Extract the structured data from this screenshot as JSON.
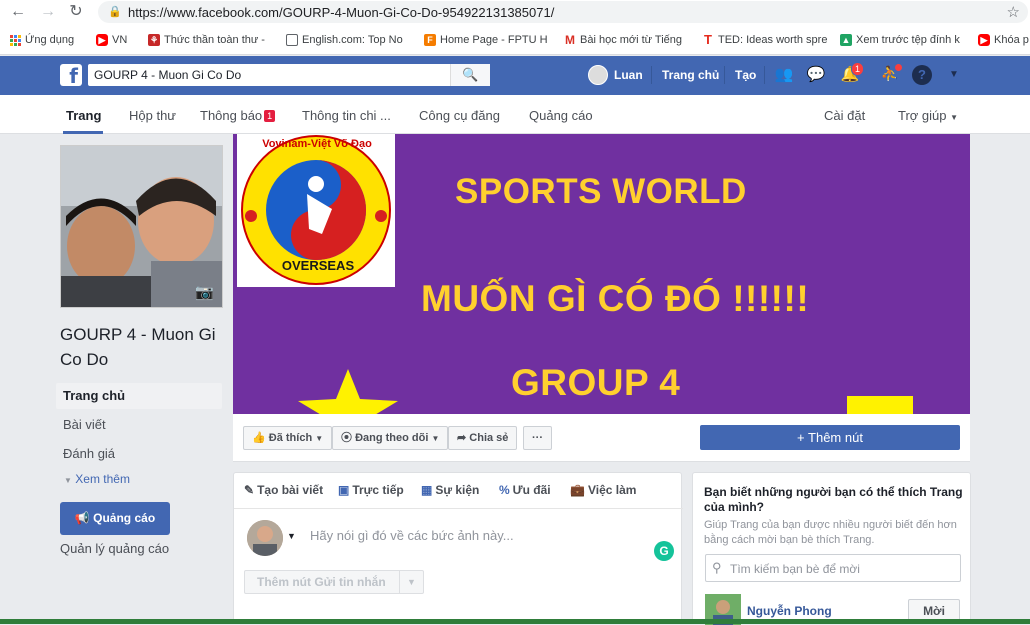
{
  "browser": {
    "url": "https://www.facebook.com/GOURP-4-Muon-Gi-Co-Do-954922131385071/",
    "bookmarks": [
      {
        "label": "Ứng dụng",
        "icon": "apps-grid-icon",
        "color": "#ea4335"
      },
      {
        "label": "VN",
        "icon": "youtube-icon",
        "color": "#ff0000"
      },
      {
        "label": "Thức thần toàn thư -",
        "icon": "site-icon",
        "color": "#c62828"
      },
      {
        "label": "English.com: Top No",
        "icon": "page-icon",
        "color": "#5f6368"
      },
      {
        "label": "Home Page - FPTU H",
        "icon": "fpt-icon",
        "color": "#f57c00"
      },
      {
        "label": "Bài học mới từ Tiếng",
        "icon": "gmail-icon",
        "color": "#d93025"
      },
      {
        "label": "TED: Ideas worth spre",
        "icon": "ted-icon",
        "color": "#e62b1e"
      },
      {
        "label": "Xem trước tệp đính k",
        "icon": "drive-icon",
        "color": "#1fa463"
      },
      {
        "label": "Khóa p",
        "icon": "youtube-icon",
        "color": "#ff0000"
      }
    ]
  },
  "fb_header": {
    "search_value": "GOURP 4 - Muon Gi Co Do",
    "user_name": "Luan",
    "home_label": "Trang chủ",
    "create_label": "Tạo",
    "notif_count": "1"
  },
  "page_tabs": {
    "items": [
      "Trang",
      "Hộp thư",
      "Thông báo",
      "Thông tin chi ...",
      "Công cụ đăng",
      "Quảng cáo"
    ],
    "notif_badge": "1",
    "settings": "Cài đặt",
    "help": "Trợ giúp"
  },
  "sidebar": {
    "page_name": "GOURP 4 - Muon Gi Co Do",
    "nav": [
      "Trang chủ",
      "Bài viết",
      "Đánh giá"
    ],
    "see_more": "Xem thêm",
    "ads_button": "Quảng cáo",
    "manage_ads": "Quản lý quảng cáo"
  },
  "cover": {
    "line1": "SPORTS WORLD",
    "line2": "MUỐN GÌ CÓ ĐÓ !!!!!!",
    "line3": "GROUP 4",
    "logo_top_text": "Vovinam-Việt Võ Đạo",
    "logo_bottom_text": "OVERSEAS"
  },
  "actions": {
    "like": "Đã thích",
    "follow": "Đang theo dõi",
    "share": "Chia sẻ",
    "more": "···",
    "add_button": "Thêm nút"
  },
  "composer": {
    "tabs": [
      "Tạo bài viết",
      "Trực tiếp",
      "Sự kiện",
      "Ưu đãi",
      "Việc làm"
    ],
    "placeholder": "Hãy nói gì đó về các bức ảnh này...",
    "message_button": "Thêm nút Gửi tin nhắn"
  },
  "suggest": {
    "title": "Bạn biết những người bạn có thể thích Trang của mình?",
    "description": "Giúp Trang của bạn được nhiều người biết đến hơn bằng cách mời bạn bè thích Trang.",
    "search_placeholder": "Tìm kiếm bạn bè để mời",
    "friend_name": "Nguyễn Phong",
    "invite_label": "Mời"
  }
}
